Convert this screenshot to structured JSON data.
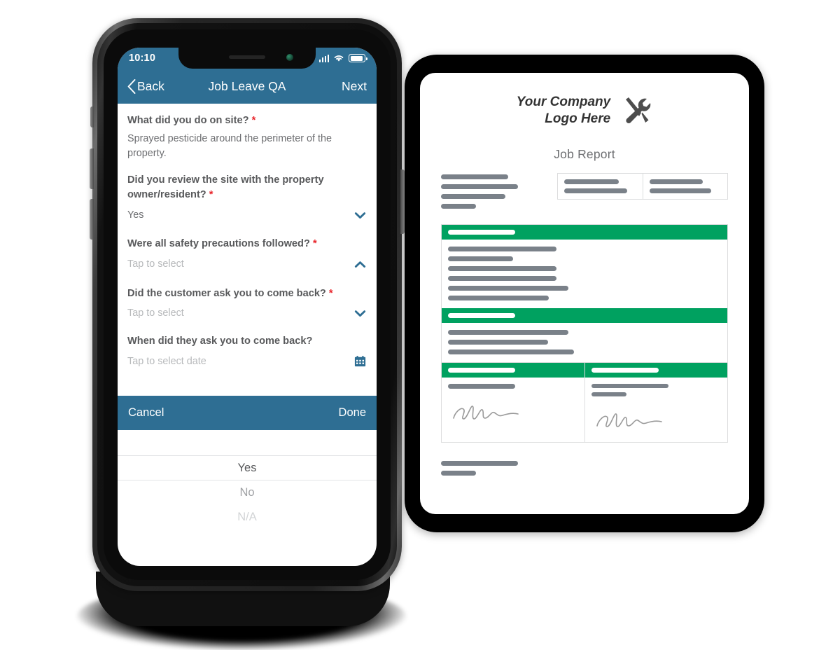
{
  "phone": {
    "status": {
      "time": "10:10",
      "signal_icon": "signal-bars-icon",
      "wifi_icon": "wifi-icon",
      "battery_icon": "battery-icon"
    },
    "nav": {
      "back_label": "Back",
      "title": "Job Leave QA",
      "next_label": "Next"
    },
    "form": {
      "questions": [
        {
          "label": "What did you do on site?",
          "required": true,
          "value": "Sprayed pesticide around the perimeter of the property.",
          "control": "textarea"
        },
        {
          "label": "Did you review the site with the property owner/resident?",
          "required": true,
          "value": "Yes",
          "control": "dropdown",
          "chevron": "chevron-down-icon"
        },
        {
          "label": "Were all safety precautions followed?",
          "required": true,
          "value": "Tap to select",
          "is_placeholder": true,
          "control": "dropdown",
          "chevron": "chevron-up-icon"
        },
        {
          "label": "Did the customer ask you to come back?",
          "required": true,
          "value": "Tap to select",
          "is_placeholder": true,
          "control": "dropdown",
          "chevron": "chevron-down-icon"
        },
        {
          "label": "When did they ask you to come back?",
          "required": false,
          "value": "Tap to select date",
          "is_placeholder": true,
          "control": "date",
          "icon": "calendar-icon"
        }
      ],
      "required_marker": "*"
    },
    "picker": {
      "cancel_label": "Cancel",
      "done_label": "Done",
      "options": [
        "Yes",
        "No",
        "N/A"
      ],
      "selected": "Yes"
    }
  },
  "tablet": {
    "document": {
      "logo_line1": "Your Company",
      "logo_line2": "Logo Here",
      "logo_icon": "wrench-screwdriver-icon",
      "title": "Job Report",
      "address_bars": [
        96,
        110,
        92,
        50
      ],
      "meta_box": {
        "left_bars": [
          78,
          90
        ],
        "right_bars": [
          76,
          88
        ]
      },
      "sections": [
        {
          "header_bar": 96,
          "body_bars": [
            155,
            93,
            155,
            155,
            172,
            144
          ]
        },
        {
          "header_bar": 96,
          "body_bars": [
            172,
            143,
            180
          ]
        }
      ],
      "signature_section": {
        "left": {
          "header_bar": 96,
          "bars": [
            96
          ],
          "signature_icon": "signature-scribble-icon"
        },
        "right": {
          "header_bar": 96,
          "bars": [
            110,
            50
          ],
          "signature_icon": "signature-scribble-icon"
        }
      },
      "footer_bars": [
        110,
        50
      ]
    }
  },
  "colors": {
    "header_blue": "#2E6E93",
    "band_green": "#00A160",
    "placeholder_gray": "#B7B9BB",
    "text_gray": "#58595B",
    "bar_gray": "#7A8189",
    "required_red": "#E8242A"
  }
}
